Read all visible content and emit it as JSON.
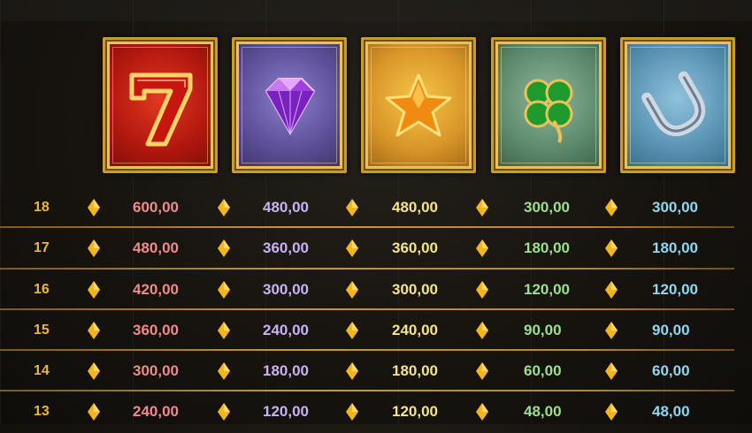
{
  "symbols": [
    {
      "name": "seven-symbol",
      "icon": "red-seven-icon"
    },
    {
      "name": "diamond-symbol",
      "icon": "purple-diamond-icon"
    },
    {
      "name": "star-symbol",
      "icon": "gold-star-icon"
    },
    {
      "name": "clover-symbol",
      "icon": "four-leaf-clover-icon"
    },
    {
      "name": "horseshoe-symbol",
      "icon": "silver-horseshoe-icon"
    }
  ],
  "colors": {
    "seven": "#f08a8a",
    "diamond": "#c9b2f2",
    "star": "#f5e48c",
    "clover": "#9ce08d",
    "horseshoe": "#8fd7ef",
    "count": "#e9b73c",
    "separator": "#c69a33"
  },
  "paytable": {
    "rows": [
      {
        "count": "18",
        "values": [
          "600,00",
          "480,00",
          "480,00",
          "300,00",
          "300,00"
        ]
      },
      {
        "count": "17",
        "values": [
          "480,00",
          "360,00",
          "360,00",
          "180,00",
          "180,00"
        ]
      },
      {
        "count": "16",
        "values": [
          "420,00",
          "300,00",
          "300,00",
          "120,00",
          "120,00"
        ]
      },
      {
        "count": "15",
        "values": [
          "360,00",
          "240,00",
          "240,00",
          "90,00",
          "90,00"
        ]
      },
      {
        "count": "14",
        "values": [
          "300,00",
          "180,00",
          "180,00",
          "60,00",
          "60,00"
        ]
      },
      {
        "count": "13",
        "values": [
          "240,00",
          "120,00",
          "120,00",
          "48,00",
          "48,00"
        ]
      }
    ]
  }
}
